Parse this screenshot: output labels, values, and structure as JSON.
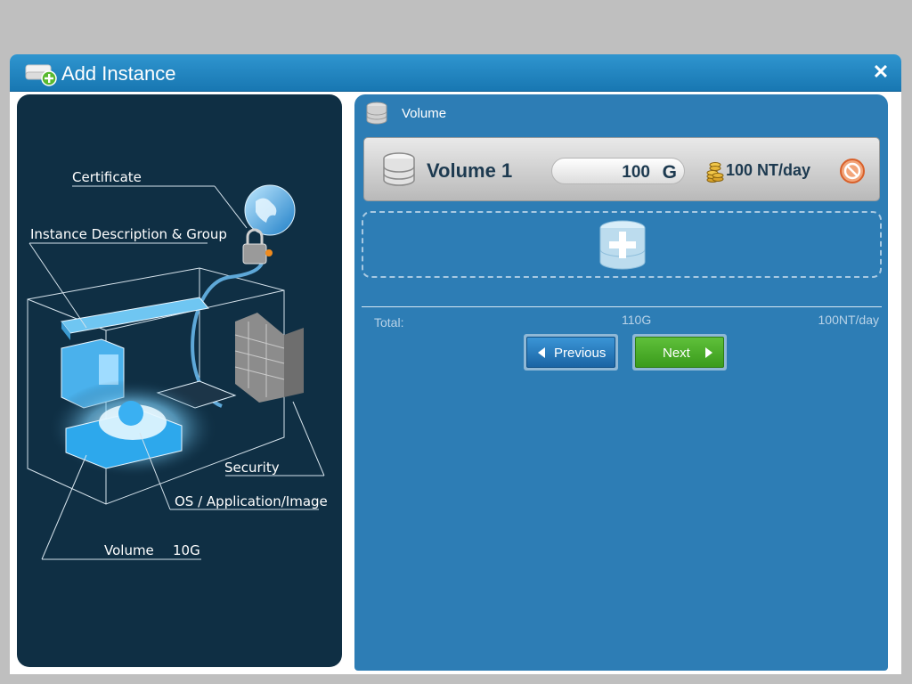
{
  "dialog": {
    "title": "Add Instance",
    "close_icon": "close-icon",
    "title_icon": "add-server-icon"
  },
  "diagram": {
    "certificate_label": "Certificate",
    "description_label": "Instance Description & Group",
    "security_label": "Security",
    "os_label": "OS / Application/Image",
    "volume_label": "Volume",
    "volume_size": "10G"
  },
  "volume_section": {
    "header_label": "Volume",
    "header_icon": "database-icon",
    "volumes": [
      {
        "name": "Volume 1",
        "size": "100",
        "unit": "G",
        "price": "100 NT/day"
      }
    ],
    "add_icon": "add-volume-icon",
    "total": {
      "label": "Total:",
      "size": "110G",
      "price": "100NT/day"
    }
  },
  "navigation": {
    "previous_label": "Previous",
    "next_label": "Next"
  },
  "colors": {
    "title_bar": "#1f86c2",
    "left_panel": "#0f2f44",
    "right_panel": "#2d7db5",
    "next_button": "#4aab27",
    "previous_button": "#2a7cc0"
  }
}
